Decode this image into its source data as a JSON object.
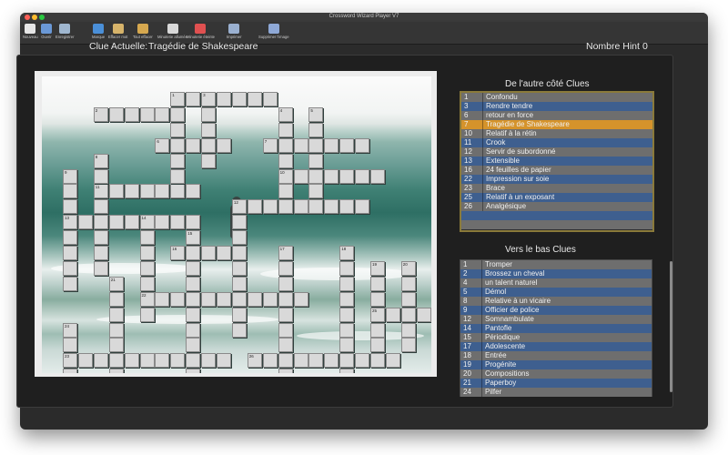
{
  "window": {
    "title": "Crossword Wizard Player V7"
  },
  "colors": {
    "close": "#ff5f57",
    "minimize": "#febc2e",
    "zoom": "#28c840",
    "selected_row": "#d5932b",
    "row_gray": "#6e6e6e",
    "row_blue": "#3e5f8f"
  },
  "toolbar": [
    {
      "label": "Nouveau",
      "icon": "new-document-icon",
      "color": "#e6e6e6"
    },
    {
      "label": "Ouvrir",
      "icon": "folder-open-icon",
      "color": "#6a98d6"
    },
    {
      "label": "Enregistrer",
      "icon": "save-disk-icon",
      "color": "#9fb6cf"
    },
    {
      "label": "Marque",
      "icon": "flag-icon",
      "color": "#4a8fd8"
    },
    {
      "label": "Effacer mot",
      "icon": "broom-icon",
      "color": "#d6b36a"
    },
    {
      "label": "Tout effacer",
      "icon": "broom-all-icon",
      "color": "#d6a84f"
    },
    {
      "label": "Minuterie allumée",
      "icon": "stopwatch-icon",
      "color": "#d8d8d8"
    },
    {
      "label": "Minuterie éteinte",
      "icon": "stopwatch-off-icon",
      "color": "#e05050"
    },
    {
      "label": "Imprimer",
      "icon": "printer-icon",
      "color": "#9ab0d0"
    },
    {
      "label": "Supprimer l'image",
      "icon": "delete-image-icon",
      "color": "#8ea8d6"
    }
  ],
  "header": {
    "clue_label": "Clue Actuelle:",
    "clue_value": "Tragédie de Shakespeare",
    "hint_label": "Nombre Hint",
    "hint_value": "0"
  },
  "across": {
    "title": "De l'autre côté Clues",
    "selected": "7",
    "items": [
      {
        "n": "1",
        "t": "Confondu"
      },
      {
        "n": "3",
        "t": "Rendre tendre"
      },
      {
        "n": "6",
        "t": "retour en force"
      },
      {
        "n": "7",
        "t": "Tragédie de Shakespeare"
      },
      {
        "n": "10",
        "t": "Relatif à la rétin"
      },
      {
        "n": "11",
        "t": "Crook"
      },
      {
        "n": "12",
        "t": "Servir de subordonné"
      },
      {
        "n": "13",
        "t": "Extensible"
      },
      {
        "n": "16",
        "t": "24 feuilles de papier"
      },
      {
        "n": "22",
        "t": "Impression sur soie"
      },
      {
        "n": "23",
        "t": "Brace"
      },
      {
        "n": "25",
        "t": "Relatif à un exposant"
      },
      {
        "n": "26",
        "t": "Analgésique"
      }
    ]
  },
  "down": {
    "title": "Vers le bas Clues",
    "items": [
      {
        "n": "1",
        "t": "Tromper"
      },
      {
        "n": "2",
        "t": "Brossez un cheval"
      },
      {
        "n": "4",
        "t": "un talent naturel"
      },
      {
        "n": "5",
        "t": "Démol"
      },
      {
        "n": "8",
        "t": "Relative à un vicaire"
      },
      {
        "n": "9",
        "t": "Officier de police"
      },
      {
        "n": "12",
        "t": "Somnambulate"
      },
      {
        "n": "14",
        "t": "Pantofle"
      },
      {
        "n": "15",
        "t": "Périodique"
      },
      {
        "n": "17",
        "t": "Adolescente"
      },
      {
        "n": "18",
        "t": "Entrée"
      },
      {
        "n": "19",
        "t": "Progénite"
      },
      {
        "n": "20",
        "t": "Compositions"
      },
      {
        "n": "21",
        "t": "Paperboy"
      },
      {
        "n": "24",
        "t": "Pilfer"
      }
    ]
  },
  "grid": {
    "numbers": [
      {
        "n": "1",
        "r": 0,
        "c": 7
      },
      {
        "n": "3",
        "r": 0,
        "c": 9
      },
      {
        "n": "2",
        "r": 1,
        "c": 2
      },
      {
        "n": "4",
        "r": 1,
        "c": 14
      },
      {
        "n": "5",
        "r": 1,
        "c": 16
      },
      {
        "n": "6",
        "r": 3,
        "c": 6
      },
      {
        "n": "7",
        "r": 3,
        "c": 13
      },
      {
        "n": "8",
        "r": 4,
        "c": 2
      },
      {
        "n": "9",
        "r": 5,
        "c": 0
      },
      {
        "n": "10",
        "r": 5,
        "c": 14
      },
      {
        "n": "11",
        "r": 6,
        "c": 2
      },
      {
        "n": "12",
        "r": 7,
        "c": 11
      },
      {
        "n": "13",
        "r": 8,
        "c": 0
      },
      {
        "n": "14",
        "r": 8,
        "c": 5
      },
      {
        "n": "15",
        "r": 9,
        "c": 8
      },
      {
        "n": "16",
        "r": 10,
        "c": 7
      },
      {
        "n": "17",
        "r": 10,
        "c": 14
      },
      {
        "n": "18",
        "r": 10,
        "c": 18
      },
      {
        "n": "19",
        "r": 11,
        "c": 20
      },
      {
        "n": "20",
        "r": 11,
        "c": 22
      },
      {
        "n": "21",
        "r": 12,
        "c": 3
      },
      {
        "n": "22",
        "r": 13,
        "c": 5
      },
      {
        "n": "25",
        "r": 14,
        "c": 20
      },
      {
        "n": "24",
        "r": 15,
        "c": 0
      },
      {
        "n": "23",
        "r": 17,
        "c": 0
      },
      {
        "n": "26",
        "r": 17,
        "c": 12
      }
    ]
  }
}
